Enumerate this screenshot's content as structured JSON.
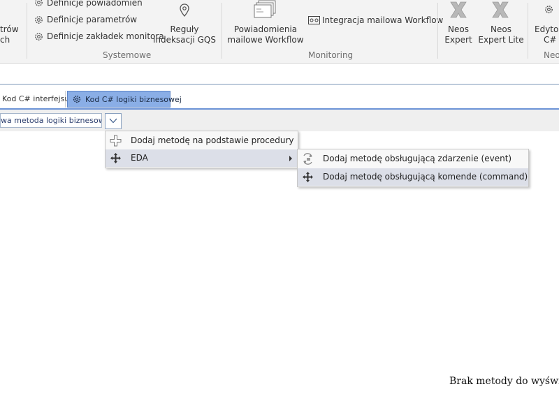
{
  "ribbon": {
    "cut_left_top": "trów",
    "cut_left_bottom": "ch",
    "systemowe_items": [
      {
        "label": "Definicje powiadomień",
        "icon": "gear-icon"
      },
      {
        "label": "Definicje parametrów",
        "icon": "gear-icon"
      },
      {
        "label": "Definicje zakładek monitora",
        "icon": "gear-icon"
      }
    ],
    "gqs_line1": "Reguły",
    "gqs_line2": "indeksacji GQS",
    "group_systemowe": "Systemowe",
    "powiadomienia_line1": "Powiadomienia",
    "powiadomienia_line2": "mailowe Workflow",
    "integracja_label": "Integracja  mailowa Workflow",
    "group_monitoring": "Monitoring",
    "neos_expert_line1": "Neos",
    "neos_expert_line2": "Expert",
    "neos_lite_line1": "Neos",
    "neos_lite_line2": "Expert Lite",
    "edytor_line1": "Edytor",
    "edytor_line2": "C#",
    "group_neos_cut": "Neo"
  },
  "tabs": [
    {
      "label": "Kod C# interfejsu",
      "active": false
    },
    {
      "label": "Kod C# logiki biznesowej",
      "active": true,
      "icon": "gear-icon"
    }
  ],
  "toolbar": {
    "combo_text": "wa metoda logiki biznesowej"
  },
  "menu": {
    "items": [
      {
        "label": "Dodaj metodę na podstawie procedury",
        "icon": "plus-icon",
        "highlighted": false
      },
      {
        "label": "EDA",
        "icon": "move-icon",
        "highlighted": true,
        "has_submenu": true
      }
    ]
  },
  "submenu": {
    "items": [
      {
        "label": "Dodaj metodę obsługującą zdarzenie (event)",
        "icon": "event-icon",
        "highlighted": false
      },
      {
        "label": "Dodaj metodę obsługującą komende (command)",
        "icon": "move-icon",
        "highlighted": true
      }
    ]
  },
  "main": {
    "empty_message": "Brak metody do wyświe"
  }
}
